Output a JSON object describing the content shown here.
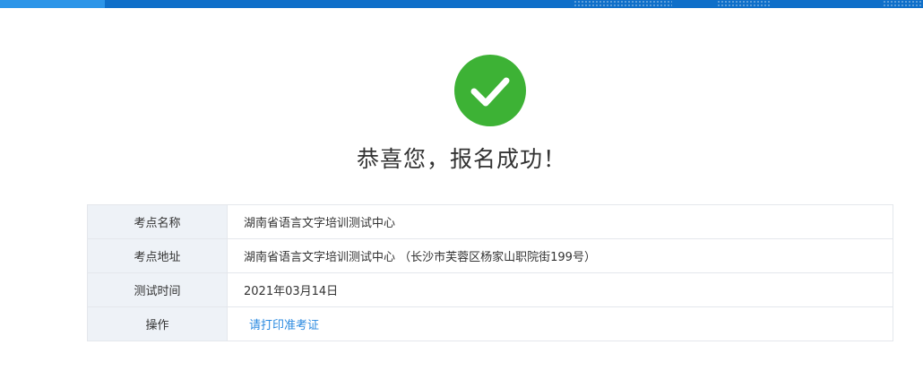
{
  "colors": {
    "header_bar": "#0f6fc9",
    "header_accent": "#2d95e8",
    "success": "#3db235",
    "link": "#2a8ae0",
    "label_bg": "#eef2f7"
  },
  "icon": "check-circle-icon",
  "headline": "恭喜您，报名成功！",
  "details": {
    "rows": [
      {
        "label": "考点名称",
        "value": "湖南省语言文字培训测试中心"
      },
      {
        "label": "考点地址",
        "value": "湖南省语言文字培训测试中心 （长沙市芙蓉区杨家山职院街199号）"
      },
      {
        "label": "测试时间",
        "value": "2021年03月14日"
      }
    ],
    "action": {
      "label": "操作",
      "link_text": "请打印准考证"
    }
  }
}
